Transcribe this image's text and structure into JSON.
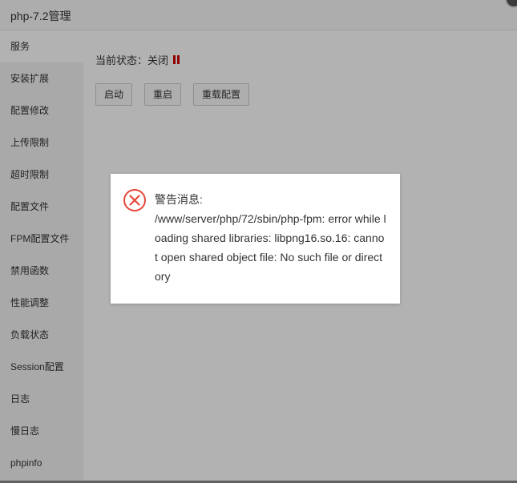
{
  "window": {
    "title": "php-7.2管理"
  },
  "sidebar": {
    "items": [
      {
        "label": "服务",
        "active": true
      },
      {
        "label": "安装扩展"
      },
      {
        "label": "配置修改"
      },
      {
        "label": "上传限制"
      },
      {
        "label": "超时限制"
      },
      {
        "label": "配置文件"
      },
      {
        "label": "FPM配置文件"
      },
      {
        "label": "禁用函数"
      },
      {
        "label": "性能调整"
      },
      {
        "label": "负载状态"
      },
      {
        "label": "Session配置"
      },
      {
        "label": "日志"
      },
      {
        "label": "慢日志"
      },
      {
        "label": "phpinfo"
      }
    ]
  },
  "main": {
    "status_label": "当前状态：",
    "status_value": "关闭",
    "status_color": "#cc0000",
    "buttons": {
      "start": "启动",
      "restart": "重启",
      "reload": "重载配置"
    }
  },
  "dialog": {
    "icon": "error-circle-x-icon",
    "icon_color": "#e8473b",
    "title": "警告消息:",
    "message": "/www/server/php/72/sbin/php-fpm: error while loading shared libraries: libpng16.so.16: cannot open shared object file: No such file or directory"
  }
}
